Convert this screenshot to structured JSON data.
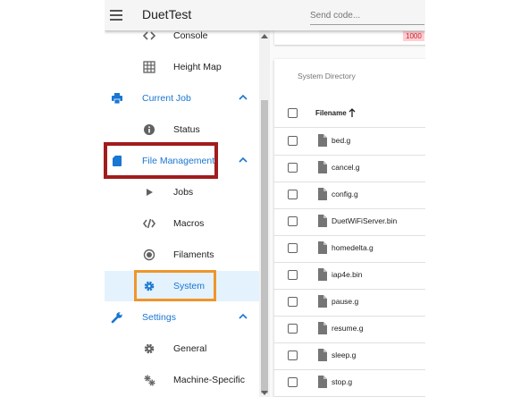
{
  "appbar": {
    "title": "DuetTest",
    "send_code_placeholder": "Send code..."
  },
  "sidebar": {
    "items": [
      {
        "label": "Console",
        "icon": "code-icon"
      },
      {
        "label": "Height Map",
        "icon": "grid-icon"
      },
      {
        "label": "Current Job",
        "icon": "printer-icon",
        "group": true,
        "expanded": true
      },
      {
        "label": "Status",
        "icon": "info-icon"
      },
      {
        "label": "File Management",
        "icon": "sd-card-icon",
        "group": true,
        "expanded": true
      },
      {
        "label": "Jobs",
        "icon": "play-icon"
      },
      {
        "label": "Macros",
        "icon": "code-slash-icon"
      },
      {
        "label": "Filaments",
        "icon": "radio-icon"
      },
      {
        "label": "System",
        "icon": "gear-icon",
        "active": true
      },
      {
        "label": "Settings",
        "icon": "wrench-icon",
        "group": true,
        "expanded": true
      },
      {
        "label": "General",
        "icon": "gear-icon"
      },
      {
        "label": "Machine-Specific",
        "icon": "gears-icon"
      }
    ]
  },
  "top_card": {
    "chip": "1000"
  },
  "directory": {
    "title": "System Directory",
    "column_header": "Filename",
    "sort": "ascending",
    "files": [
      "bed.g",
      "cancel.g",
      "config.g",
      "DuetWiFiServer.bin",
      "homedelta.g",
      "iap4e.bin",
      "pause.g",
      "resume.g",
      "sleep.g",
      "stop.g"
    ]
  },
  "colors": {
    "accent": "#1976d2",
    "highlight_red": "#a11c1c",
    "highlight_orange": "#f0952b",
    "active_bg": "#e3f2fd"
  }
}
